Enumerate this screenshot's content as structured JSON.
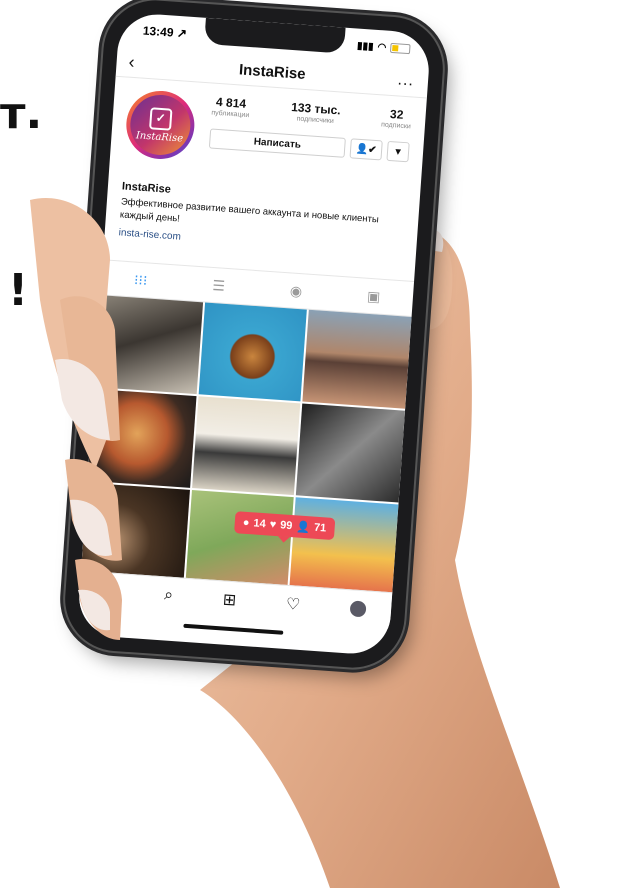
{
  "background": {
    "line1": "т.",
    "line2": "!"
  },
  "status_bar": {
    "time": "13:49",
    "location_arrow": "↗",
    "signal": "▮▮▮",
    "wifi": "wifi-icon"
  },
  "header": {
    "title": "InstaRise",
    "back": "‹",
    "more": "..."
  },
  "profile": {
    "avatar_brand": "InstaRise",
    "stats": [
      {
        "value": "4 814",
        "label": "публикации"
      },
      {
        "value": "133 тыс.",
        "label": "подписчики"
      },
      {
        "value": "32",
        "label": "подписки"
      }
    ],
    "message_button": "Написать",
    "follow_icon": "👤✔",
    "dropdown_icon": "▾"
  },
  "bio": {
    "name": "InstaRise",
    "description": "Эффективное развитие вашего аккаунта и новые клиенты каждый день!",
    "link": "insta-rise.com"
  },
  "tabs": [
    "grid-icon",
    "list-icon",
    "location-icon",
    "tagged-icon"
  ],
  "notification": {
    "comments": "14",
    "likes": "99",
    "followers": "71"
  },
  "colors": {
    "accent": "#3897f0",
    "notification": "#ed4956",
    "link": "#2a4f86"
  }
}
